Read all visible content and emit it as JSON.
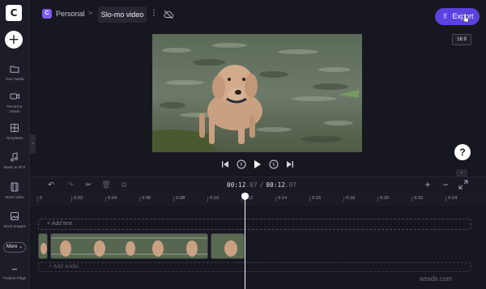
{
  "app": {
    "logo_letter": "C"
  },
  "sidebar": {
    "add_label": "+",
    "items": [
      {
        "label": "Your media",
        "icon": "folder-icon"
      },
      {
        "label": "Record & create",
        "icon": "camera-icon"
      },
      {
        "label": "Templates",
        "icon": "templates-icon"
      },
      {
        "label": "Music & SFX",
        "icon": "music-icon"
      },
      {
        "label": "Stock video",
        "icon": "film-icon"
      },
      {
        "label": "Stock images",
        "icon": "image-icon"
      }
    ],
    "more_label": "More ⌄",
    "feature_flags_label": "Feature Flags",
    "dots_label": "•••"
  },
  "header": {
    "workspace_initial": "C",
    "workspace_name": "Personal",
    "breadcrumb_separator": ">",
    "project_title": "Slo-mo video",
    "kebab": "⋮",
    "export_label": "Export",
    "aspect_ratio": "16:9"
  },
  "preview": {
    "help_label": "?",
    "collapse_label": "›",
    "expand_label": "⌄"
  },
  "timeline": {
    "current_time": "00:12",
    "current_frames": ".07",
    "total_time": "00:12",
    "total_frames": ".07",
    "time_separator": "/",
    "ruler": [
      "0",
      "0:02",
      "0:04",
      "0:06",
      "0:08",
      "0:10",
      "0:12",
      "0:14",
      "0:16",
      "0:18",
      "0:20",
      "0:22",
      "0:24"
    ],
    "text_track_label": "+ Add text",
    "audio_track_label": "+ Add audio",
    "zoom_in_label": "+",
    "zoom_out_label": "−"
  },
  "colors": {
    "accent": "#5a42e0",
    "workspace_chip": "#7d5cf5",
    "background": "#17171f"
  },
  "watermark": "wsxdn.com"
}
